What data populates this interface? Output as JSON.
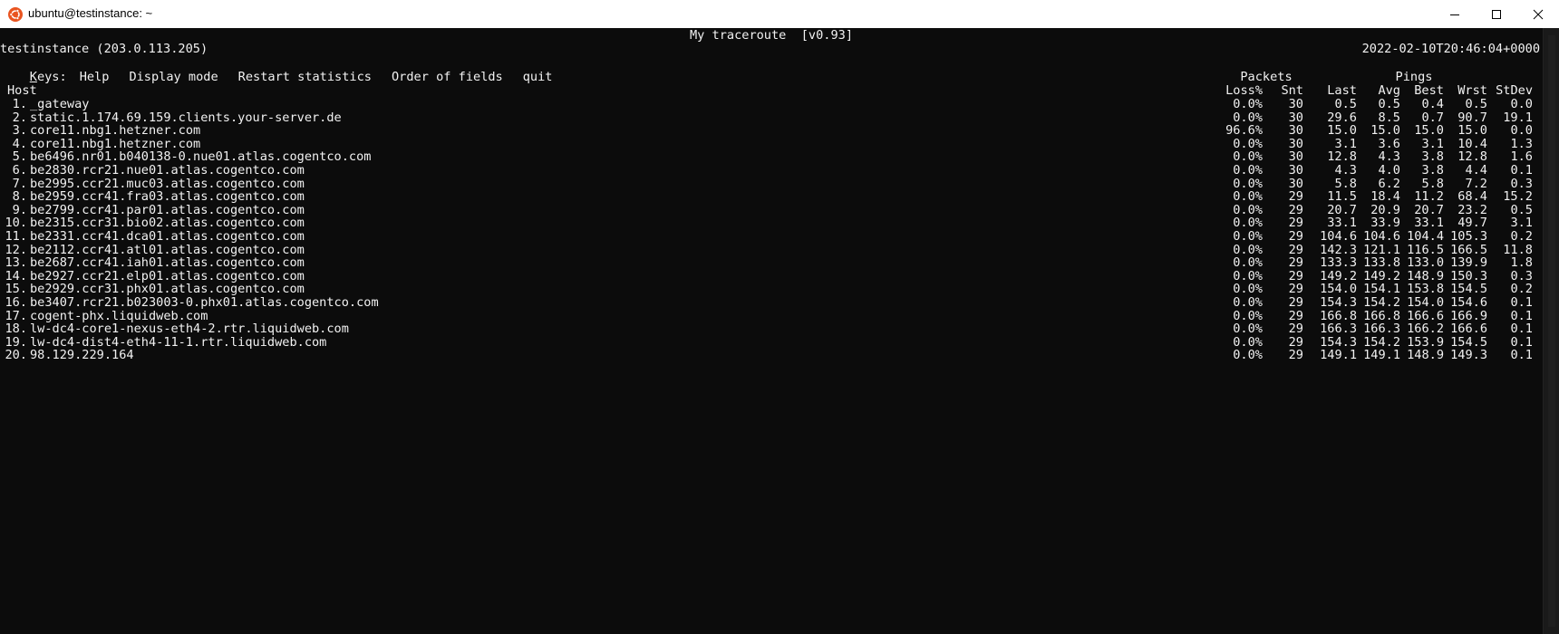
{
  "window": {
    "title": "ubuntu@testinstance: ~",
    "icon": "ubuntu-icon"
  },
  "terminal": {
    "app_title": "My traceroute  [v0.93]",
    "host_line": "testinstance (203.0.113.205)",
    "datetime": "2022-02-10T20:46:04+0000",
    "keys_label_first": "K",
    "keys_label_rest": "eys:",
    "keys": [
      "Help",
      "Display mode",
      "Restart statistics",
      "Order of fields",
      "quit"
    ],
    "group_headers": {
      "packets": "Packets",
      "pings": "Pings"
    },
    "columns": {
      "host": "Host",
      "loss": "Loss%",
      "snt": "Snt",
      "last": "Last",
      "avg": "Avg",
      "best": "Best",
      "wrst": "Wrst",
      "stdev": "StDev"
    },
    "hops": [
      {
        "num": "1.",
        "host": "_gateway",
        "loss": "0.0%",
        "snt": "30",
        "last": "0.5",
        "avg": "0.5",
        "best": "0.4",
        "wrst": "0.5",
        "stdev": "0.0"
      },
      {
        "num": "2.",
        "host": "static.1.174.69.159.clients.your-server.de",
        "loss": "0.0%",
        "snt": "30",
        "last": "29.6",
        "avg": "8.5",
        "best": "0.7",
        "wrst": "90.7",
        "stdev": "19.1"
      },
      {
        "num": "3.",
        "host": "core11.nbg1.hetzner.com",
        "loss": "96.6%",
        "snt": "30",
        "last": "15.0",
        "avg": "15.0",
        "best": "15.0",
        "wrst": "15.0",
        "stdev": "0.0"
      },
      {
        "num": "4.",
        "host": "core11.nbg1.hetzner.com",
        "loss": "0.0%",
        "snt": "30",
        "last": "3.1",
        "avg": "3.6",
        "best": "3.1",
        "wrst": "10.4",
        "stdev": "1.3"
      },
      {
        "num": "5.",
        "host": "be6496.nr01.b040138-0.nue01.atlas.cogentco.com",
        "loss": "0.0%",
        "snt": "30",
        "last": "12.8",
        "avg": "4.3",
        "best": "3.8",
        "wrst": "12.8",
        "stdev": "1.6"
      },
      {
        "num": "6.",
        "host": "be2830.rcr21.nue01.atlas.cogentco.com",
        "loss": "0.0%",
        "snt": "30",
        "last": "4.3",
        "avg": "4.0",
        "best": "3.8",
        "wrst": "4.4",
        "stdev": "0.1"
      },
      {
        "num": "7.",
        "host": "be2995.ccr21.muc03.atlas.cogentco.com",
        "loss": "0.0%",
        "snt": "30",
        "last": "5.8",
        "avg": "6.2",
        "best": "5.8",
        "wrst": "7.2",
        "stdev": "0.3"
      },
      {
        "num": "8.",
        "host": "be2959.ccr41.fra03.atlas.cogentco.com",
        "loss": "0.0%",
        "snt": "29",
        "last": "11.5",
        "avg": "18.4",
        "best": "11.2",
        "wrst": "68.4",
        "stdev": "15.2"
      },
      {
        "num": "9.",
        "host": "be2799.ccr41.par01.atlas.cogentco.com",
        "loss": "0.0%",
        "snt": "29",
        "last": "20.7",
        "avg": "20.9",
        "best": "20.7",
        "wrst": "23.2",
        "stdev": "0.5"
      },
      {
        "num": "10.",
        "host": "be2315.ccr31.bio02.atlas.cogentco.com",
        "loss": "0.0%",
        "snt": "29",
        "last": "33.1",
        "avg": "33.9",
        "best": "33.1",
        "wrst": "49.7",
        "stdev": "3.1"
      },
      {
        "num": "11.",
        "host": "be2331.ccr41.dca01.atlas.cogentco.com",
        "loss": "0.0%",
        "snt": "29",
        "last": "104.6",
        "avg": "104.6",
        "best": "104.4",
        "wrst": "105.3",
        "stdev": "0.2"
      },
      {
        "num": "12.",
        "host": "be2112.ccr41.atl01.atlas.cogentco.com",
        "loss": "0.0%",
        "snt": "29",
        "last": "142.3",
        "avg": "121.1",
        "best": "116.5",
        "wrst": "166.5",
        "stdev": "11.8"
      },
      {
        "num": "13.",
        "host": "be2687.ccr41.iah01.atlas.cogentco.com",
        "loss": "0.0%",
        "snt": "29",
        "last": "133.3",
        "avg": "133.8",
        "best": "133.0",
        "wrst": "139.9",
        "stdev": "1.8"
      },
      {
        "num": "14.",
        "host": "be2927.ccr21.elp01.atlas.cogentco.com",
        "loss": "0.0%",
        "snt": "29",
        "last": "149.2",
        "avg": "149.2",
        "best": "148.9",
        "wrst": "150.3",
        "stdev": "0.3"
      },
      {
        "num": "15.",
        "host": "be2929.ccr31.phx01.atlas.cogentco.com",
        "loss": "0.0%",
        "snt": "29",
        "last": "154.0",
        "avg": "154.1",
        "best": "153.8",
        "wrst": "154.5",
        "stdev": "0.2"
      },
      {
        "num": "16.",
        "host": "be3407.rcr21.b023003-0.phx01.atlas.cogentco.com",
        "loss": "0.0%",
        "snt": "29",
        "last": "154.3",
        "avg": "154.2",
        "best": "154.0",
        "wrst": "154.6",
        "stdev": "0.1"
      },
      {
        "num": "17.",
        "host": "cogent-phx.liquidweb.com",
        "loss": "0.0%",
        "snt": "29",
        "last": "166.8",
        "avg": "166.8",
        "best": "166.6",
        "wrst": "166.9",
        "stdev": "0.1"
      },
      {
        "num": "18.",
        "host": "lw-dc4-core1-nexus-eth4-2.rtr.liquidweb.com",
        "loss": "0.0%",
        "snt": "29",
        "last": "166.3",
        "avg": "166.3",
        "best": "166.2",
        "wrst": "166.6",
        "stdev": "0.1"
      },
      {
        "num": "19.",
        "host": "lw-dc4-dist4-eth4-11-1.rtr.liquidweb.com",
        "loss": "0.0%",
        "snt": "29",
        "last": "154.3",
        "avg": "154.2",
        "best": "153.9",
        "wrst": "154.5",
        "stdev": "0.1"
      },
      {
        "num": "20.",
        "host": "98.129.229.164",
        "loss": "0.0%",
        "snt": "29",
        "last": "149.1",
        "avg": "149.1",
        "best": "148.9",
        "wrst": "149.3",
        "stdev": "0.1"
      }
    ]
  },
  "colors": {
    "terminal_bg": "#0c0c0c",
    "terminal_fg": "#cccccc",
    "titlebar_bg": "#ffffff",
    "ubuntu_orange": "#e95420"
  }
}
